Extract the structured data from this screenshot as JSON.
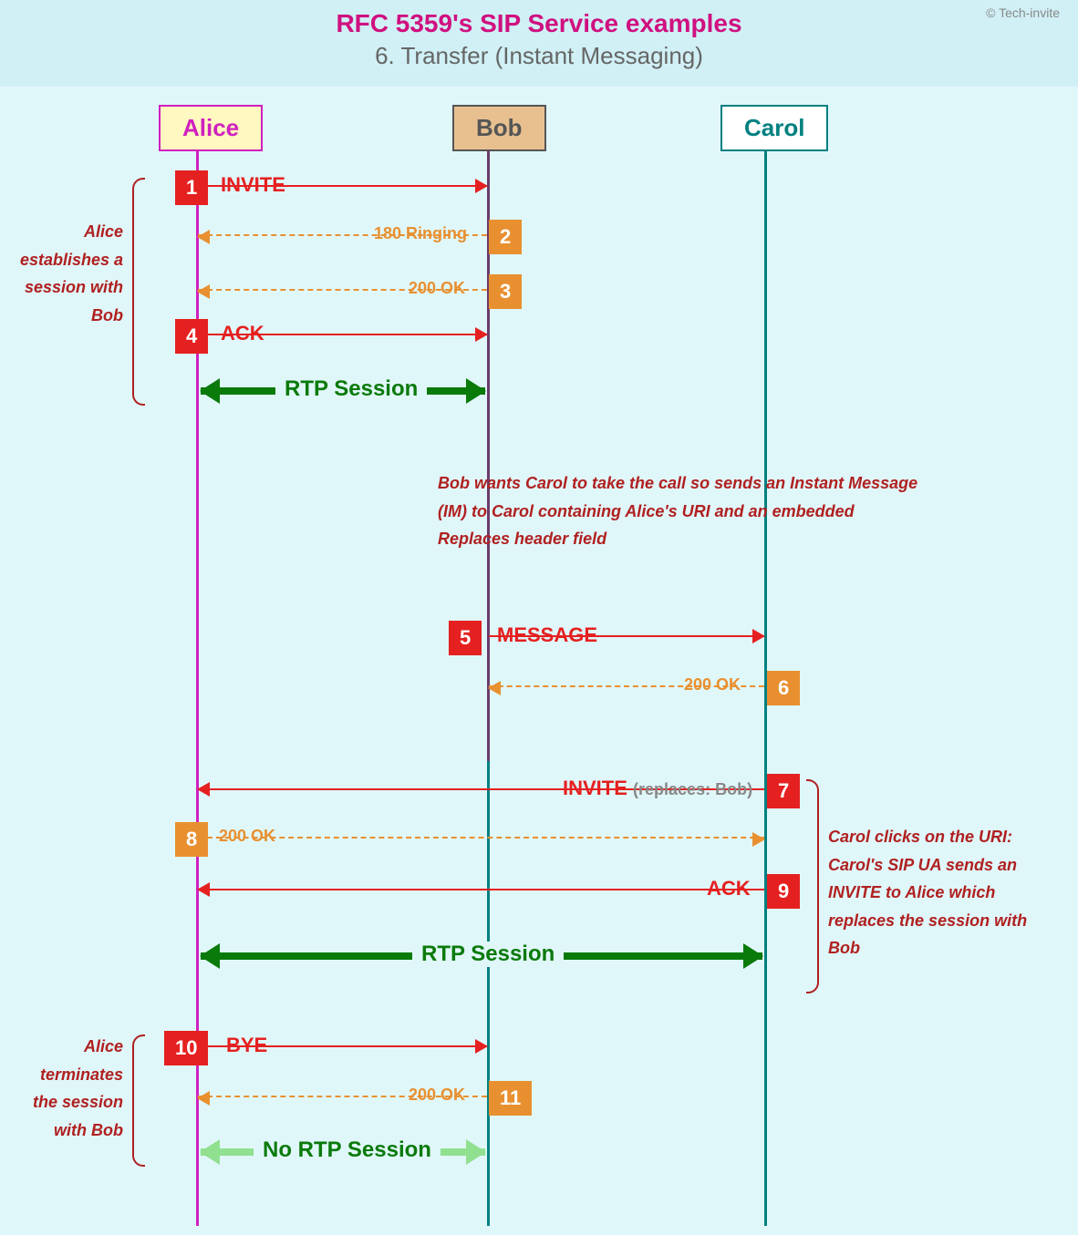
{
  "header": {
    "title": "RFC 5359's SIP Service examples",
    "subtitle": "6. Transfer (Instant Messaging)",
    "copyright": "© Tech-invite"
  },
  "actors": {
    "alice": "Alice",
    "bob": "Bob",
    "carol": "Carol"
  },
  "steps": {
    "s1": {
      "n": "1",
      "label": "INVITE"
    },
    "s2": {
      "n": "2",
      "label": "180 Ringing"
    },
    "s3": {
      "n": "3",
      "label": "200 OK"
    },
    "s4": {
      "n": "4",
      "label": "ACK"
    },
    "s5": {
      "n": "5",
      "label": "MESSAGE"
    },
    "s6": {
      "n": "6",
      "label": "200 OK"
    },
    "s7": {
      "n": "7",
      "label": "INVITE",
      "extra": "(replaces: Bob)"
    },
    "s8": {
      "n": "8",
      "label": "200 OK"
    },
    "s9": {
      "n": "9",
      "label": "ACK"
    },
    "s10": {
      "n": "10",
      "label": "BYE"
    },
    "s11": {
      "n": "11",
      "label": "200 OK"
    }
  },
  "rtp": {
    "session": "RTP Session",
    "none": "No RTP Session"
  },
  "notes": {
    "a": "Alice establishes a session with Bob",
    "b": "Bob wants Carol to take the call so sends an Instant Message (IM) to Carol containing Alice's URI and an embedded Replaces header field",
    "c": "Carol clicks on the URI: Carol's SIP UA sends an INVITE to Alice which replaces the session with Bob",
    "d": "Alice terminates the session with Bob"
  }
}
